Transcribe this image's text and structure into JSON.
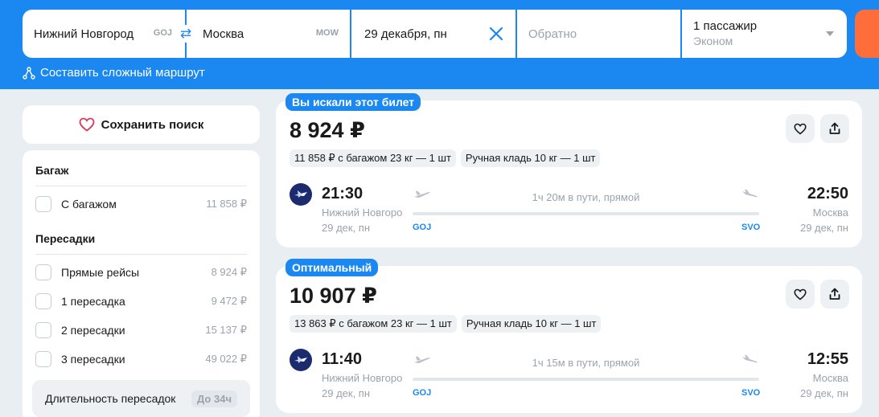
{
  "search": {
    "from_city": "Нижний Новгород",
    "from_code": "GOJ",
    "to_city": "Москва",
    "to_code": "MOW",
    "date": "29 декабря, пн",
    "return_placeholder": "Обратно",
    "passengers": "1 пассажир",
    "cabin_class": "Эконом"
  },
  "complex_route_label": "Составить сложный маршрут",
  "save_search_label": "Сохранить поиск",
  "filters": {
    "baggage_title": "Багаж",
    "baggage_options": [
      {
        "label": "С багажом",
        "price": "11 858 ₽"
      }
    ],
    "transfers_title": "Пересадки",
    "transfer_options": [
      {
        "label": "Прямые рейсы",
        "price": "8 924 ₽"
      },
      {
        "label": "1 пересадка",
        "price": "9 472 ₽"
      },
      {
        "label": "2 пересадки",
        "price": "15 137 ₽"
      },
      {
        "label": "3 пересадки",
        "price": "49 022 ₽"
      }
    ],
    "duration_label": "Длительность пересадок",
    "duration_value": "До 34ч"
  },
  "results": [
    {
      "badge": "Вы искали этот билет",
      "price": "8 924 ₽",
      "tags": [
        "11 858 ₽ с багажом 23 кг — 1 шт",
        "Ручная кладь 10 кг — 1 шт"
      ],
      "dep_time": "21:30",
      "dep_city": "Нижний Новгород",
      "dep_date": "29 дек, пн",
      "dep_code": "GOJ",
      "arr_time": "22:50",
      "arr_city": "Москва",
      "arr_date": "29 дек, пн",
      "arr_code": "SVO",
      "duration": "1ч 20м в пути, прямой"
    },
    {
      "badge": "Оптимальный",
      "price": "10 907 ₽",
      "tags": [
        "13 863 ₽ с багажом 23 кг — 1 шт",
        "Ручная кладь 10 кг — 1 шт"
      ],
      "dep_time": "11:40",
      "dep_city": "Нижний Новгород",
      "dep_date": "29 дек, пн",
      "dep_code": "GOJ",
      "arr_time": "12:55",
      "arr_city": "Москва",
      "arr_date": "29 дек, пн",
      "arr_code": "SVO",
      "duration": "1ч 15м в пути, прямой"
    }
  ],
  "colors": {
    "brand_blue": "#1a88f0",
    "search_orange": "#ff6d3b",
    "muted_text": "#9aa3ad"
  }
}
